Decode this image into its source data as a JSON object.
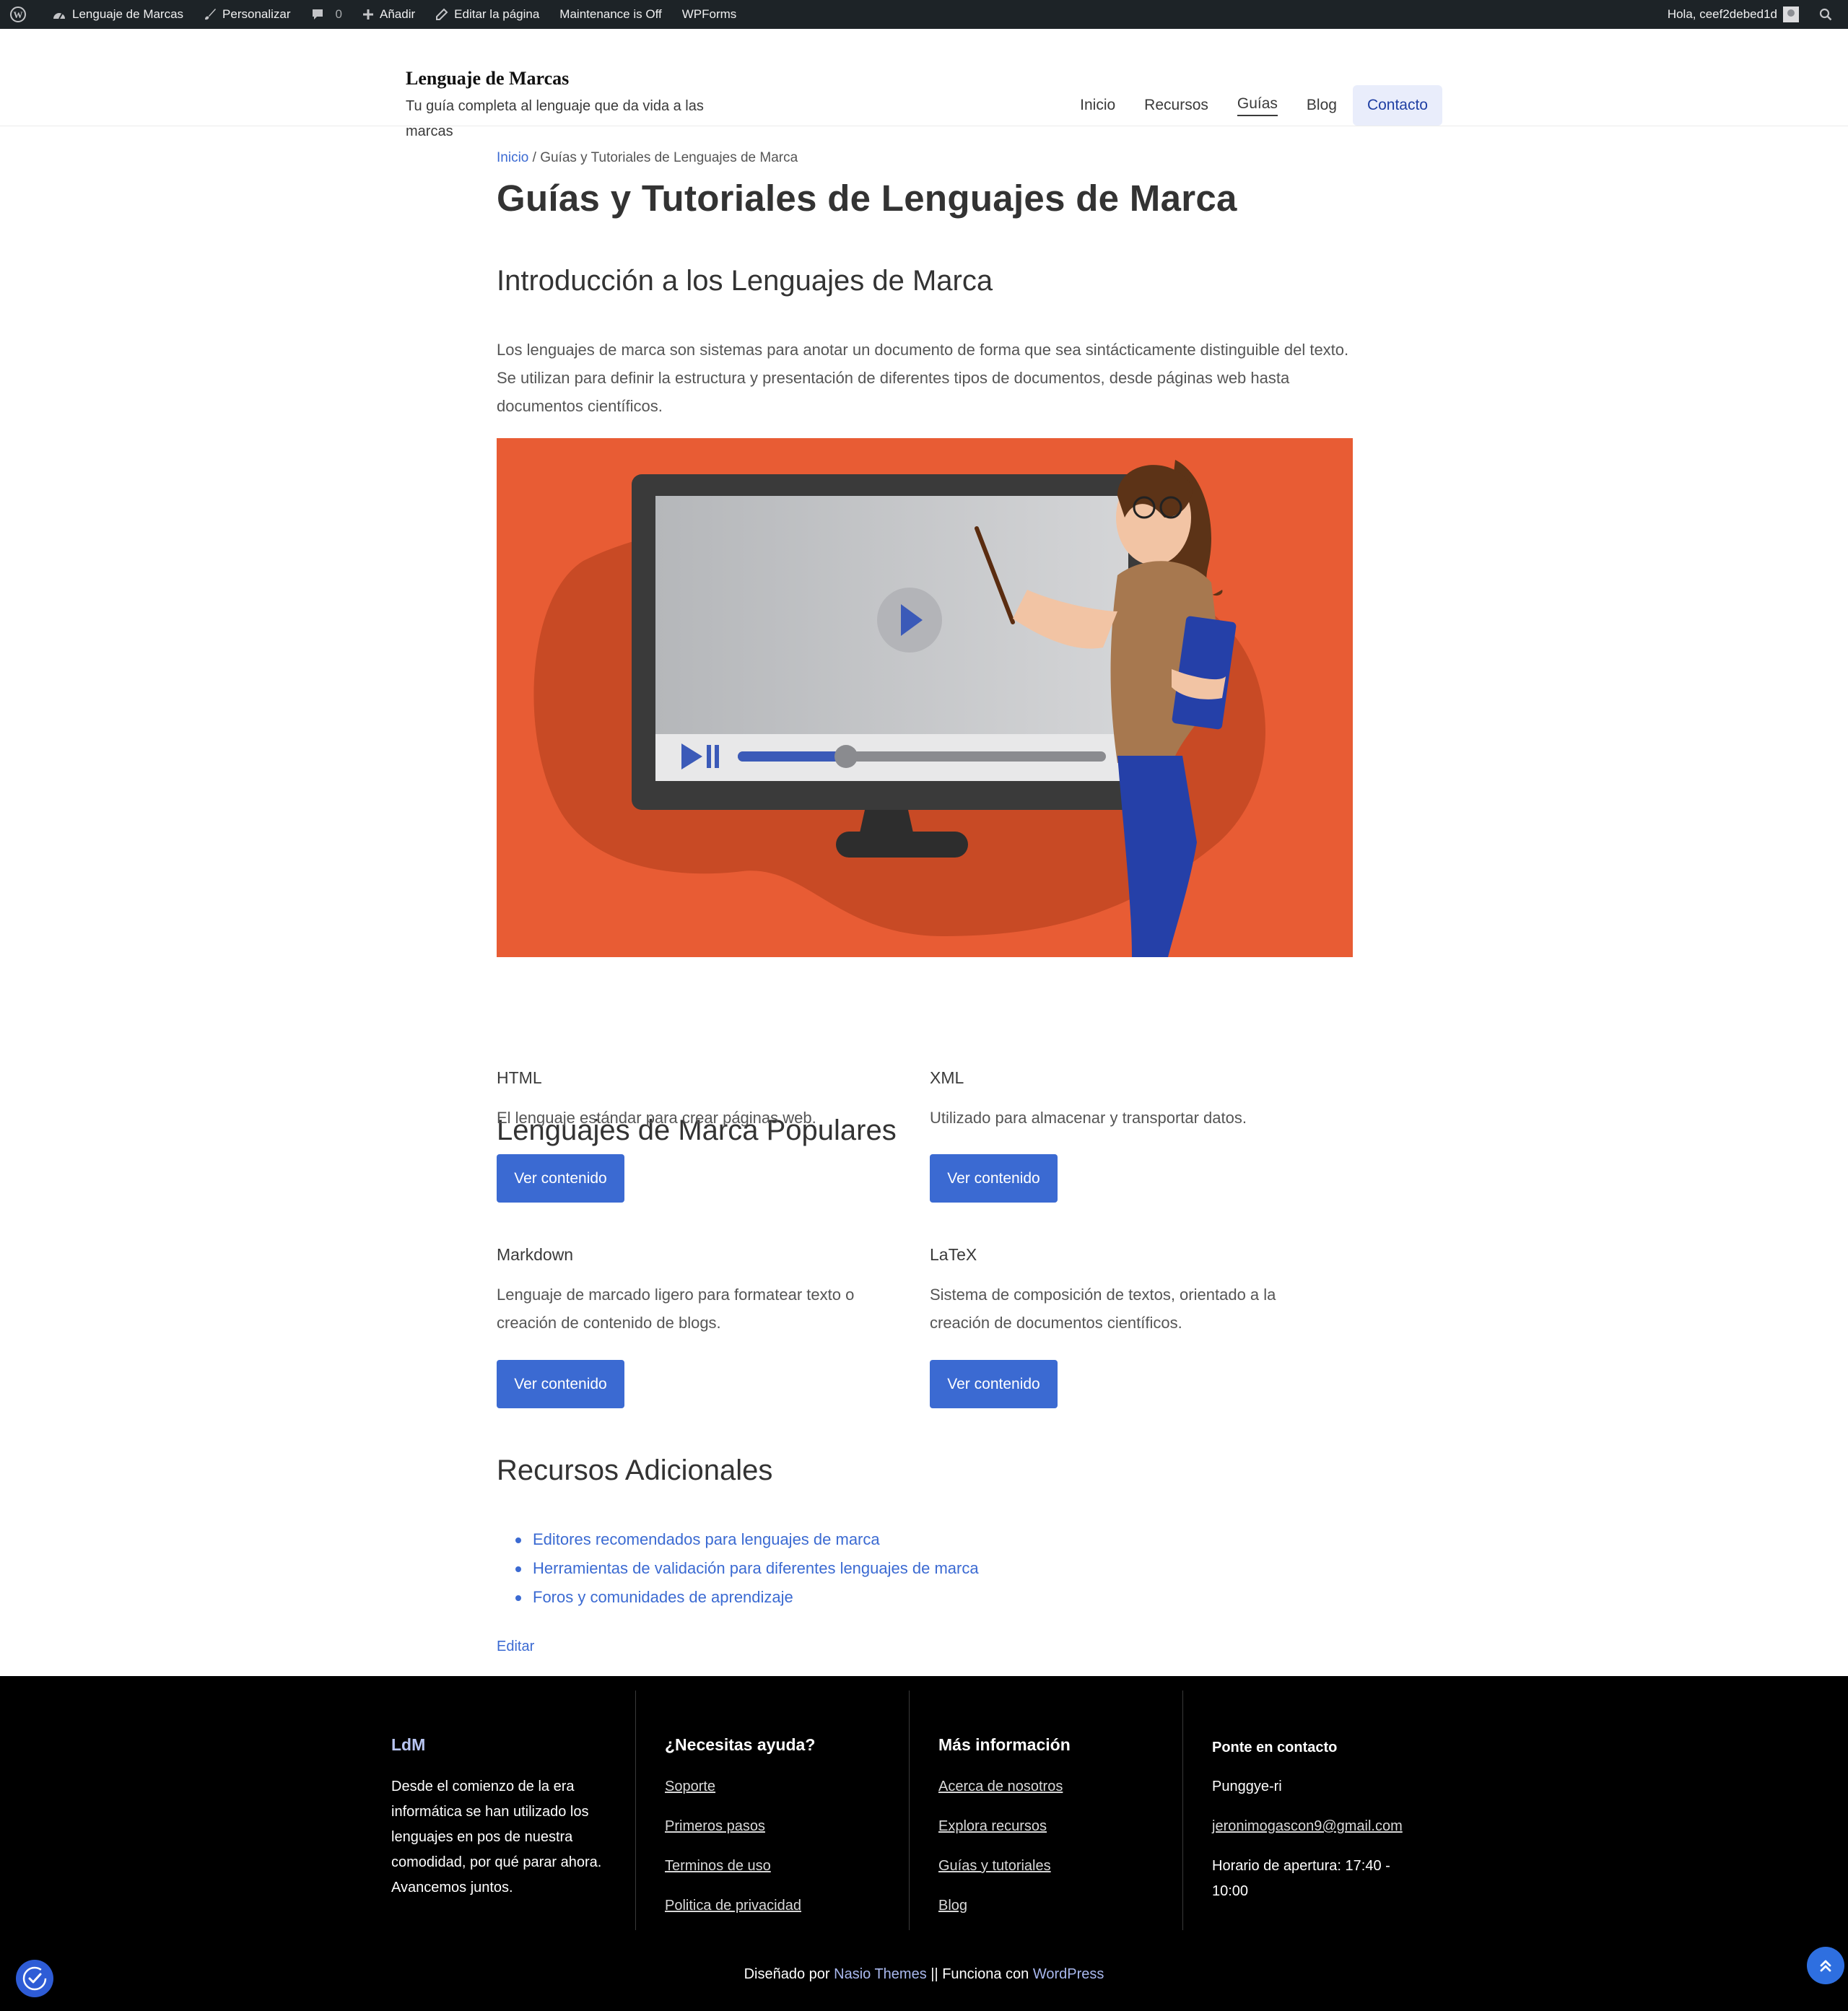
{
  "adminbar": {
    "site_name": "Lenguaje de Marcas",
    "customize": "Personalizar",
    "comments_count": "0",
    "add_new": "Añadir",
    "edit_page": "Editar la página",
    "maintenance": "Maintenance is Off",
    "wpforms": "WPForms",
    "greeting": "Hola, ceef2debed1d"
  },
  "header": {
    "site_title": "Lenguaje de Marcas",
    "tagline": "Tu guía completa al lenguaje que da vida a las marcas",
    "nav": [
      {
        "label": "Inicio"
      },
      {
        "label": "Recursos"
      },
      {
        "label": "Guías"
      },
      {
        "label": "Blog"
      },
      {
        "label": "Contacto"
      }
    ]
  },
  "breadcrumb": {
    "home": "Inicio",
    "separator": " / ",
    "current": "Guías y Tutoriales de Lenguajes de Marca"
  },
  "page": {
    "title": "Guías y Tutoriales de Lenguajes de Marca",
    "intro_heading": "Introducción a los Lenguajes de Marca",
    "intro_text": "Los lenguajes de marca son sistemas para anotar un documento de forma que sea sintácticamente distinguible del texto. Se utilizan para definir la estructura y presentación de diferentes tipos de documentos, desde páginas web hasta documentos científicos.",
    "popular_heading": "Lenguajes de Marca Populares",
    "cards": [
      {
        "title": "HTML",
        "desc": "El lenguaje estándar para crear páginas web.",
        "button": "Ver contenido"
      },
      {
        "title": "XML",
        "desc": "Utilizado para almacenar y transportar datos.",
        "button": "Ver contenido"
      },
      {
        "title": "Markdown",
        "desc": "Lenguaje de marcado ligero para formatear texto o creación de contenido de blogs.",
        "button": "Ver contenido"
      },
      {
        "title": "LaTeX",
        "desc": "Sistema de composición de textos, orientado a la creación de documentos científicos.",
        "button": "Ver contenido"
      }
    ],
    "resources_heading": "Recursos Adicionales",
    "resources": [
      "Editores recomendados para lenguajes de marca",
      "Herramientas de validación para diferentes lenguajes de marca",
      "Foros y comunidades de aprendizaje"
    ],
    "edit_link": "Editar"
  },
  "footer": {
    "col1": {
      "heading": "LdM",
      "text": "Desde el comienzo de la era informática se han utilizado los lenguajes en pos de nuestra comodidad, por qué parar ahora. Avancemos juntos."
    },
    "col2": {
      "heading": "¿Necesitas ayuda?",
      "links": [
        "Soporte",
        "Primeros pasos",
        "Terminos de uso",
        "Politica de privacidad"
      ]
    },
    "col3": {
      "heading": "Más información",
      "links": [
        "Acerca de nosotros",
        "Explora recursos",
        "Guías y tutoriales",
        "Blog"
      ]
    },
    "col4": {
      "heading": "Ponte en contacto",
      "location": "Punggye-ri",
      "email": "jeronimogascon9@gmail.com",
      "hours": "Horario de apertura: 17:40 - 10:00"
    },
    "credits": {
      "designed_by": "Diseñado por ",
      "theme": "Nasio Themes",
      "separator": " || Funciona con ",
      "wordpress": "WordPress"
    }
  },
  "icons": {
    "wp_logo": "wordpress-icon",
    "dashboard": "dashboard-icon",
    "brush": "brush-icon",
    "comment": "comment-icon",
    "plus": "plus-icon",
    "pencil": "pencil-icon",
    "search": "search-icon",
    "accessibility": "accessibility-icon",
    "scroll_top": "chevrons-up-icon"
  },
  "colors": {
    "accent": "#3b6ad2",
    "hero_bg": "#e85c34",
    "admin_bar": "#1d2327",
    "footer_bg": "#000000"
  }
}
